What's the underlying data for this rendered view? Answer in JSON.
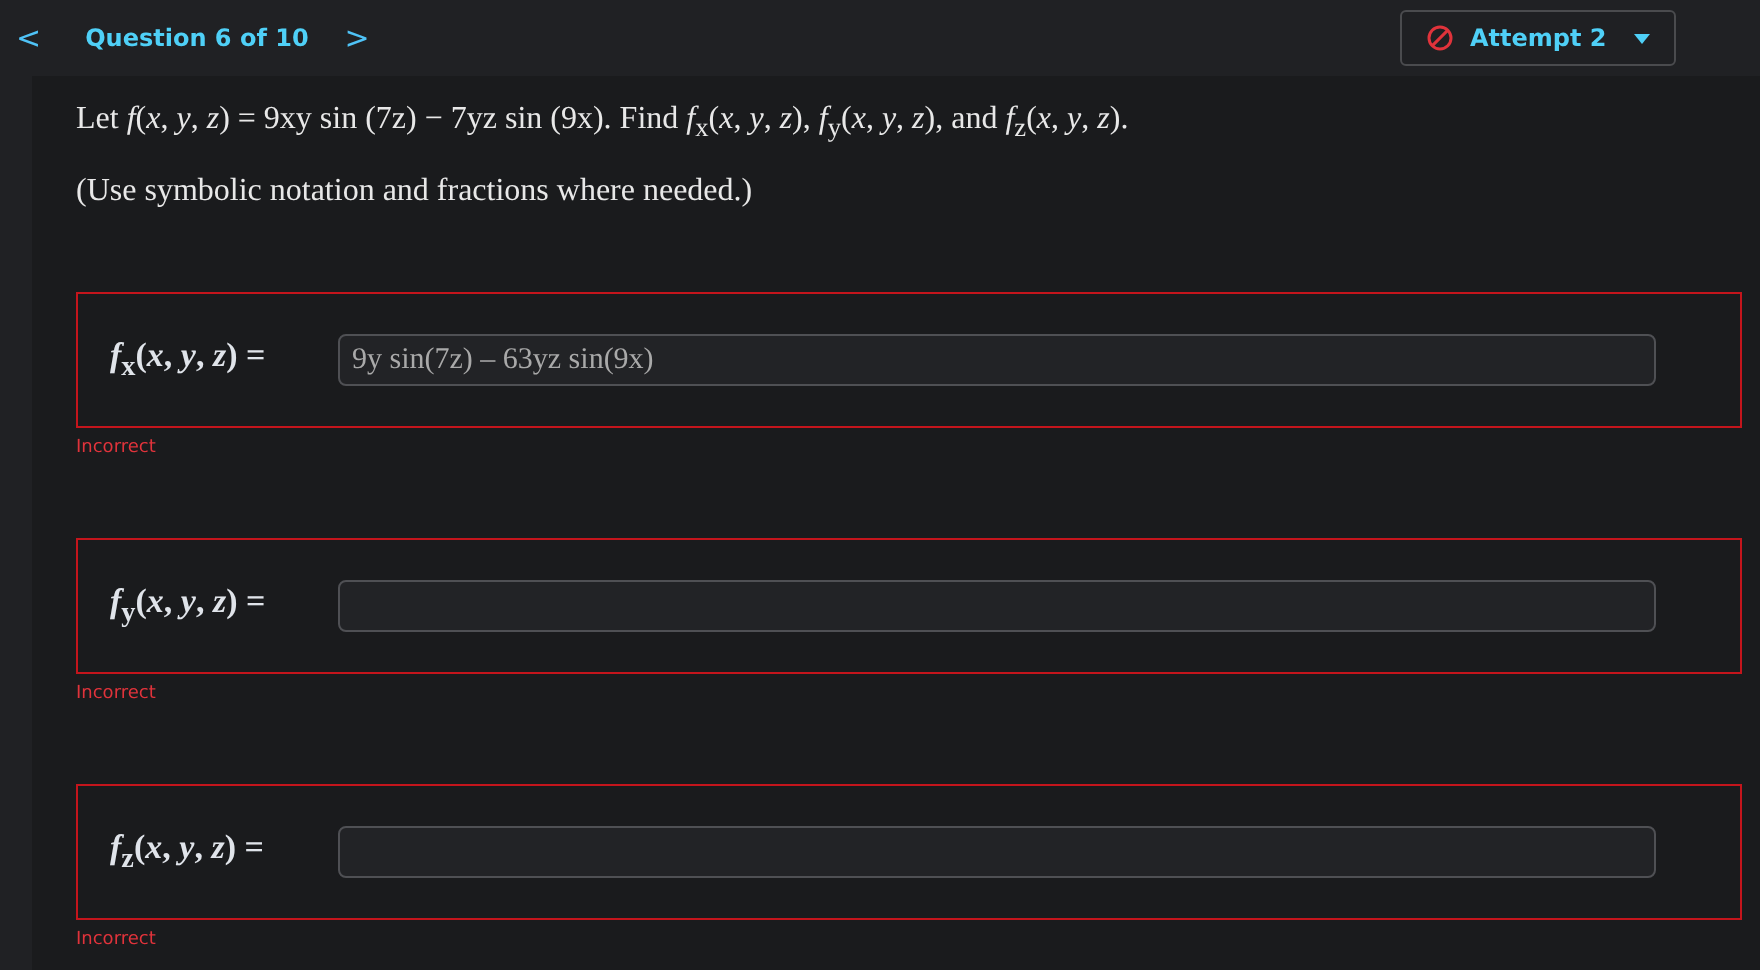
{
  "nav": {
    "prev": "<",
    "title": "Question 6 of 10",
    "next": ">"
  },
  "attempt": {
    "label": "Attempt 2",
    "blocked": true
  },
  "question": {
    "text": "Let *f*(*x*, *y*, *z*) = 9xy sin (7z) − 7yz sin (9x). Find *f*$_{x}$(*x*, *y*, *z*), *f*$_{y}$(*x*, *y*, *z*), and *f*$_{z}$(*x*, *y*, *z*).",
    "note": "(Use symbolic notation and fractions where needed.)"
  },
  "parts": [
    {
      "label": "*f*$_{x}$(*x*, *y*, *z*) =",
      "value": "9y sin(7z) – 63yz sin(9x)",
      "correct": false,
      "feedback": "Incorrect"
    },
    {
      "label": "*f*$_{y}$(*x*, *y*, *z*) =",
      "correct": false,
      "feedback": "Incorrect"
    },
    {
      "label": "*f*$_{z}$(*x*, *y*, *z*) =",
      "correct": false,
      "feedback": "Incorrect"
    }
  ]
}
